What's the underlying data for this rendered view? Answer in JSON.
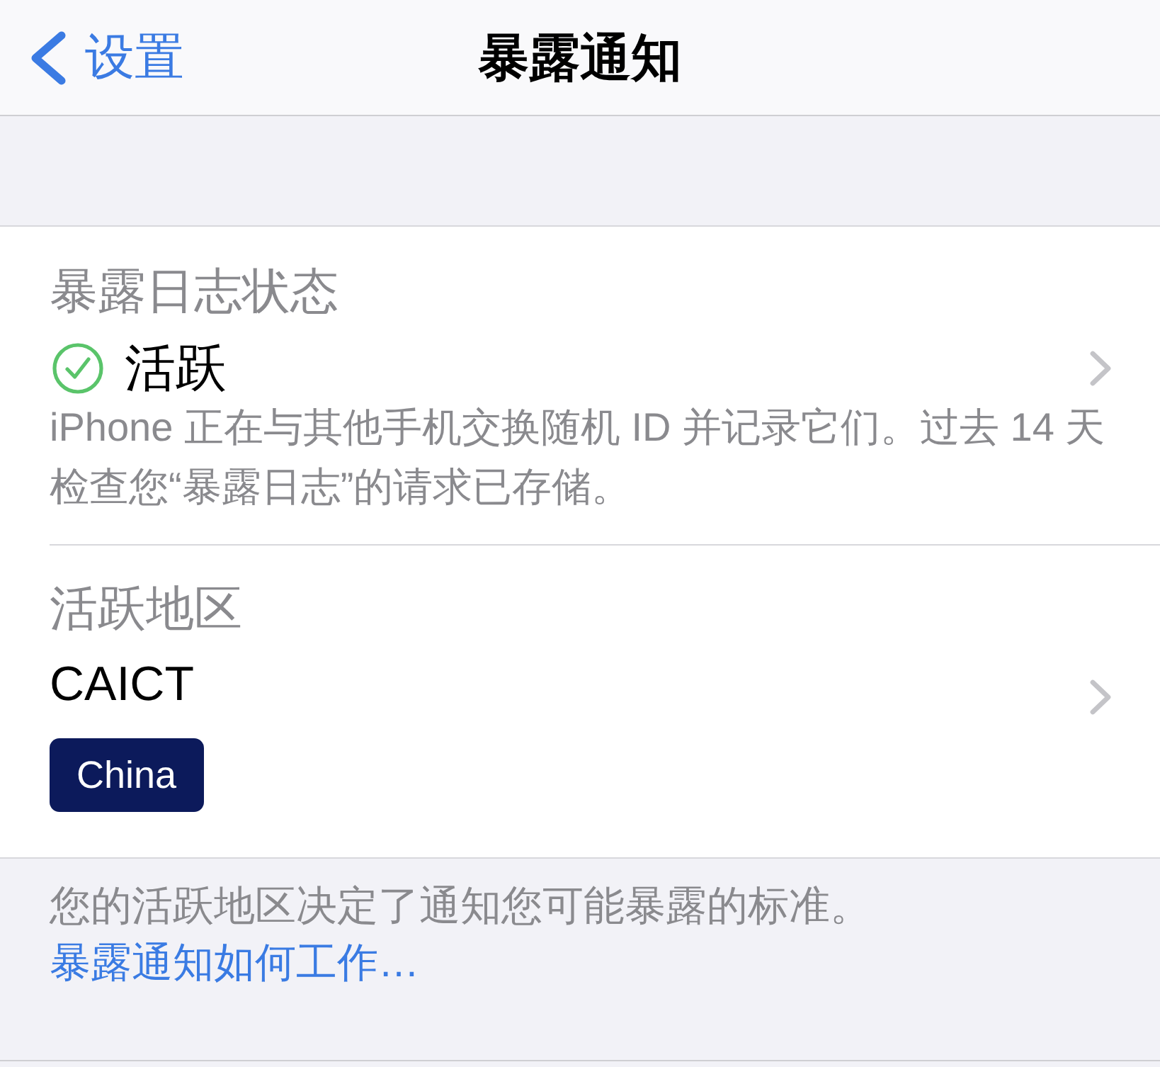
{
  "nav_bar": {
    "back_label": "设置",
    "title": "暴露通知"
  },
  "rows": [
    {
      "kind": "status",
      "label": "暴露日志状态",
      "value": "活跃",
      "active": true,
      "description": "iPhone 正在与其他手机交换随机 ID 并记录它们。过去 14 天检查您“暴露日志”的请求已存储。"
    },
    {
      "kind": "region",
      "label": "活跃地区",
      "value": "CAICT",
      "badge": "China"
    }
  ],
  "footer": {
    "text": "您的活跃地区决定了通知您可能暴露的标准。",
    "link": "暴露通知如何工作…"
  }
}
